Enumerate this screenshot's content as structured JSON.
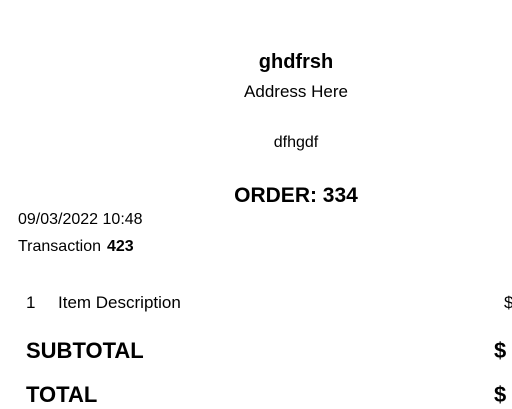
{
  "header": {
    "store_name": "ghdfrsh",
    "address": "Address Here",
    "note": "dfhgdf",
    "order": "ORDER: 334"
  },
  "meta": {
    "datetime": "09/03/2022 10:48",
    "transaction_label": "Transaction",
    "transaction_number": "423"
  },
  "items": [
    {
      "qty": "1",
      "description": "Item Description",
      "price": "$"
    }
  ],
  "totals": {
    "subtotal_label": "SUBTOTAL",
    "subtotal_value": "$",
    "total_label": "TOTAL",
    "total_value": "$"
  }
}
